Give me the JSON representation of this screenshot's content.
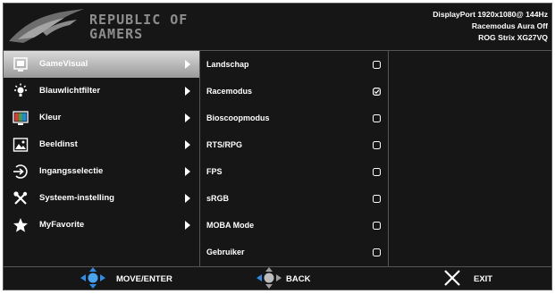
{
  "logo": {
    "line1": "REPUBLIC OF",
    "line2": "GAMERS"
  },
  "info": {
    "signal": "DisplayPort  1920x1080@  144Hz",
    "mode": "Racemodus Aura Off",
    "model": "ROG Strix XG27VQ"
  },
  "menu": {
    "items": [
      {
        "label": "GameVisual",
        "icon": "gamevisual-icon",
        "selected": true
      },
      {
        "label": "Blauwlichtfilter",
        "icon": "bluelight-icon"
      },
      {
        "label": "Kleur",
        "icon": "color-icon"
      },
      {
        "label": "Beeldinst",
        "icon": "image-icon"
      },
      {
        "label": "Ingangsselectie",
        "icon": "input-icon"
      },
      {
        "label": "Systeem-instelling",
        "icon": "tools-icon"
      },
      {
        "label": "MyFavorite",
        "icon": "star-icon"
      }
    ]
  },
  "submenu": {
    "items": [
      {
        "label": "Landschap",
        "state": "radio"
      },
      {
        "label": "Racemodus",
        "state": "checked"
      },
      {
        "label": "Bioscoopmodus",
        "state": "radio"
      },
      {
        "label": "RTS/RPG",
        "state": "radio"
      },
      {
        "label": "FPS",
        "state": "radio"
      },
      {
        "label": "sRGB",
        "state": "radio"
      },
      {
        "label": "MOBA Mode",
        "state": "radio"
      },
      {
        "label": "Gebruiker",
        "state": "radio"
      }
    ]
  },
  "footer": {
    "move_enter": "MOVE/ENTER",
    "back": "BACK",
    "exit": "EXIT"
  },
  "colors": {
    "accent_blue": "#2f8ce6",
    "bg": "#161616",
    "divider": "#555555"
  }
}
